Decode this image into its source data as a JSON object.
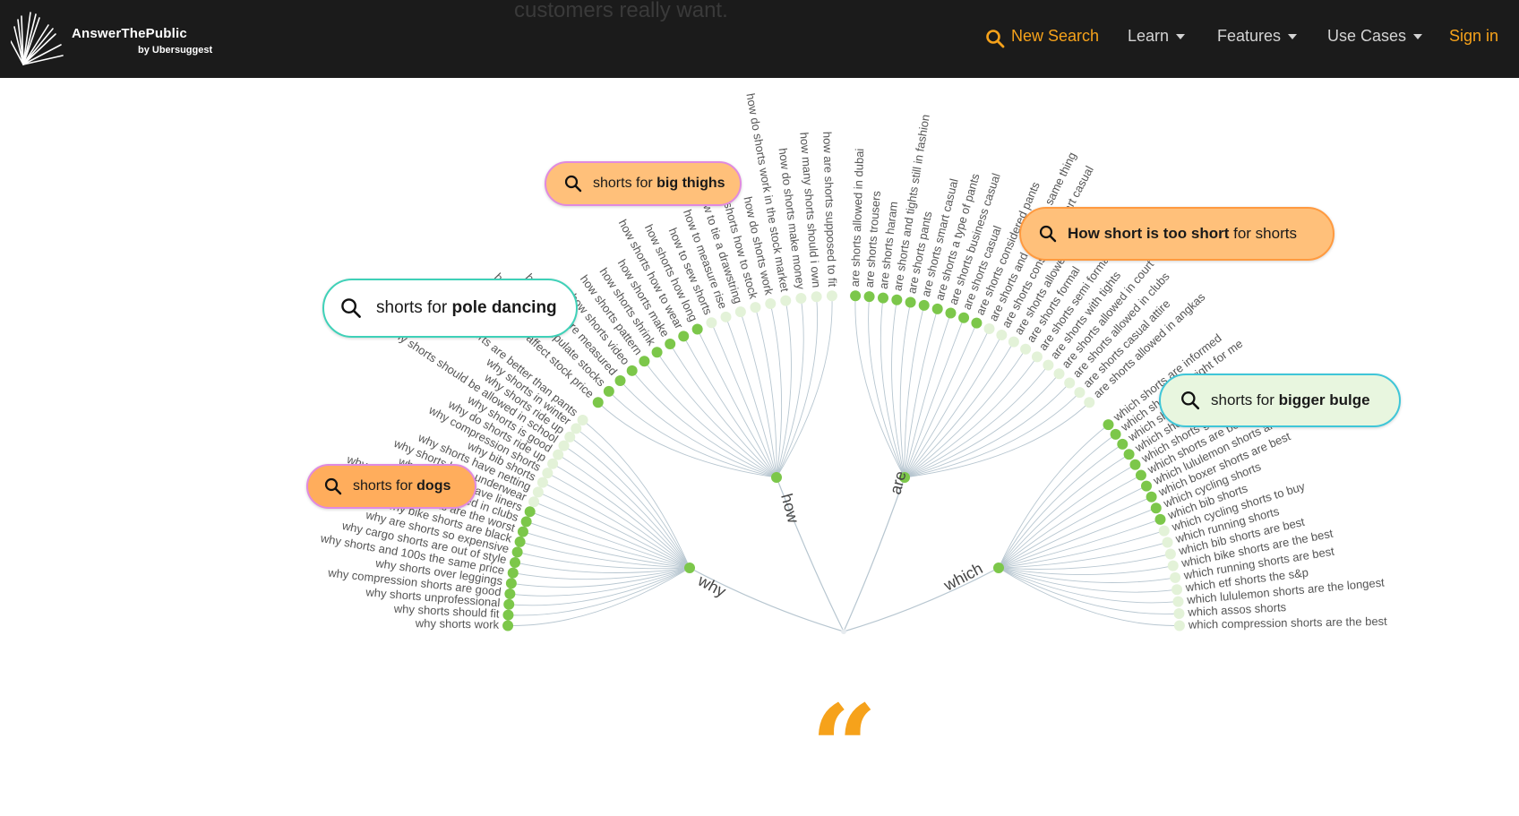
{
  "nav": {
    "brand_name": "AnswerThePublic",
    "brand_sub": "by Ubersuggest",
    "hero_tail": "customers really want.",
    "new_search": "New Search",
    "learn": "Learn",
    "features": "Features",
    "use_cases": "Use Cases",
    "sign_in": "Sign in"
  },
  "accent": "#f6a21b",
  "wheel": {
    "why": {
      "label": "why",
      "items": [
        "why shorts work",
        "why shorts should fit",
        "why shorts unprofessional",
        "why compression shorts are good",
        "why shorts over leggings",
        "why shorts and 100s the same price",
        "why cargo shorts are out of style",
        "why are shorts so expensive",
        "why bike shorts are black",
        "why cargo shorts are the worst",
        "why are shorts not allowed in clubs",
        "why do shorts have liners",
        "why shorts have underwear",
        "why shorts have netting",
        "why bib shorts",
        "why compression shorts",
        "why do shorts ride up",
        "why shorts is good",
        "why shorts should be allowed in school",
        "why shorts ride up",
        "why shorts in winter",
        "why shorts are better than pants"
      ]
    },
    "how": {
      "label": "how",
      "items": [
        "how shorts affect stock price",
        "how shorts manipulate stocks",
        "how shorts are measured",
        "how shorts video",
        "how shorts pattern",
        "how shorts shrink",
        "how shorts make",
        "how shorts how to wear",
        "how shorts how long",
        "how to sew shorts",
        "how to measure rise",
        "how to tie a drawstring",
        "how shorts how to stock",
        "how do shorts work",
        "how do shorts work in the stock market",
        "how do shorts make money",
        "how many shorts should i own",
        "how are shorts supposed to fit"
      ]
    },
    "are": {
      "label": "are",
      "items": [
        "are shorts allowed in dubai",
        "are shorts trousers",
        "are shorts haram",
        "are shorts and tights still in fashion",
        "are shorts pants",
        "are shorts smart casual",
        "are shorts a type of pants",
        "are shorts business casual",
        "are shorts casual",
        "are shorts considered pants",
        "are shorts and pants the same thing",
        "are shorts considered smart casual",
        "are shorts allowed in church",
        "are shorts formal",
        "are shorts semi formal 2019",
        "are shorts with tights",
        "are shorts allowed in court",
        "are shorts allowed in clubs",
        "are shorts casual attire",
        "are shorts allowed in angkas"
      ]
    },
    "which": {
      "label": "which",
      "items": [
        "which shorts are informed",
        "which shorts are right for me",
        "which shorts suit me",
        "which shorts for mtb",
        "which shorts go with black shirts",
        "which shorts are best",
        "which lululemon shorts are best",
        "which boxer shorts are best",
        "which cycling shorts",
        "which bib shorts",
        "which cycling shorts to buy",
        "which running shorts",
        "which bib shorts are best",
        "which bike shorts are the best",
        "which running shorts are best",
        "which etf shorts the s&p",
        "which lululemon shorts are the longest",
        "which assos shorts",
        "which compression shorts are the best"
      ]
    }
  },
  "pills": {
    "big_thighs": {
      "prefix": "shorts for ",
      "bold": "big thighs"
    },
    "pole_dancing": {
      "prefix": "shorts for ",
      "bold": "pole dancing"
    },
    "dogs": {
      "prefix": "shorts for ",
      "bold": "dogs"
    },
    "too_short": {
      "bold": "How short is too short",
      "suffix": " for shorts"
    },
    "bigger_bulge": {
      "prefix": "shorts for ",
      "bold": "bigger bulge"
    }
  },
  "colors": {
    "pill_orange": "#ffc07a",
    "pill_orange_dark": "#ffad5c",
    "pill_border_pink": "#e08adf",
    "pill_border_teal": "#3fd1b8",
    "pill_green": "#e8f6df",
    "dot_green": "#7cc74a",
    "dot_light": "#e3f2d8",
    "line": "#b7c6d0"
  },
  "quote_glyph": "“"
}
